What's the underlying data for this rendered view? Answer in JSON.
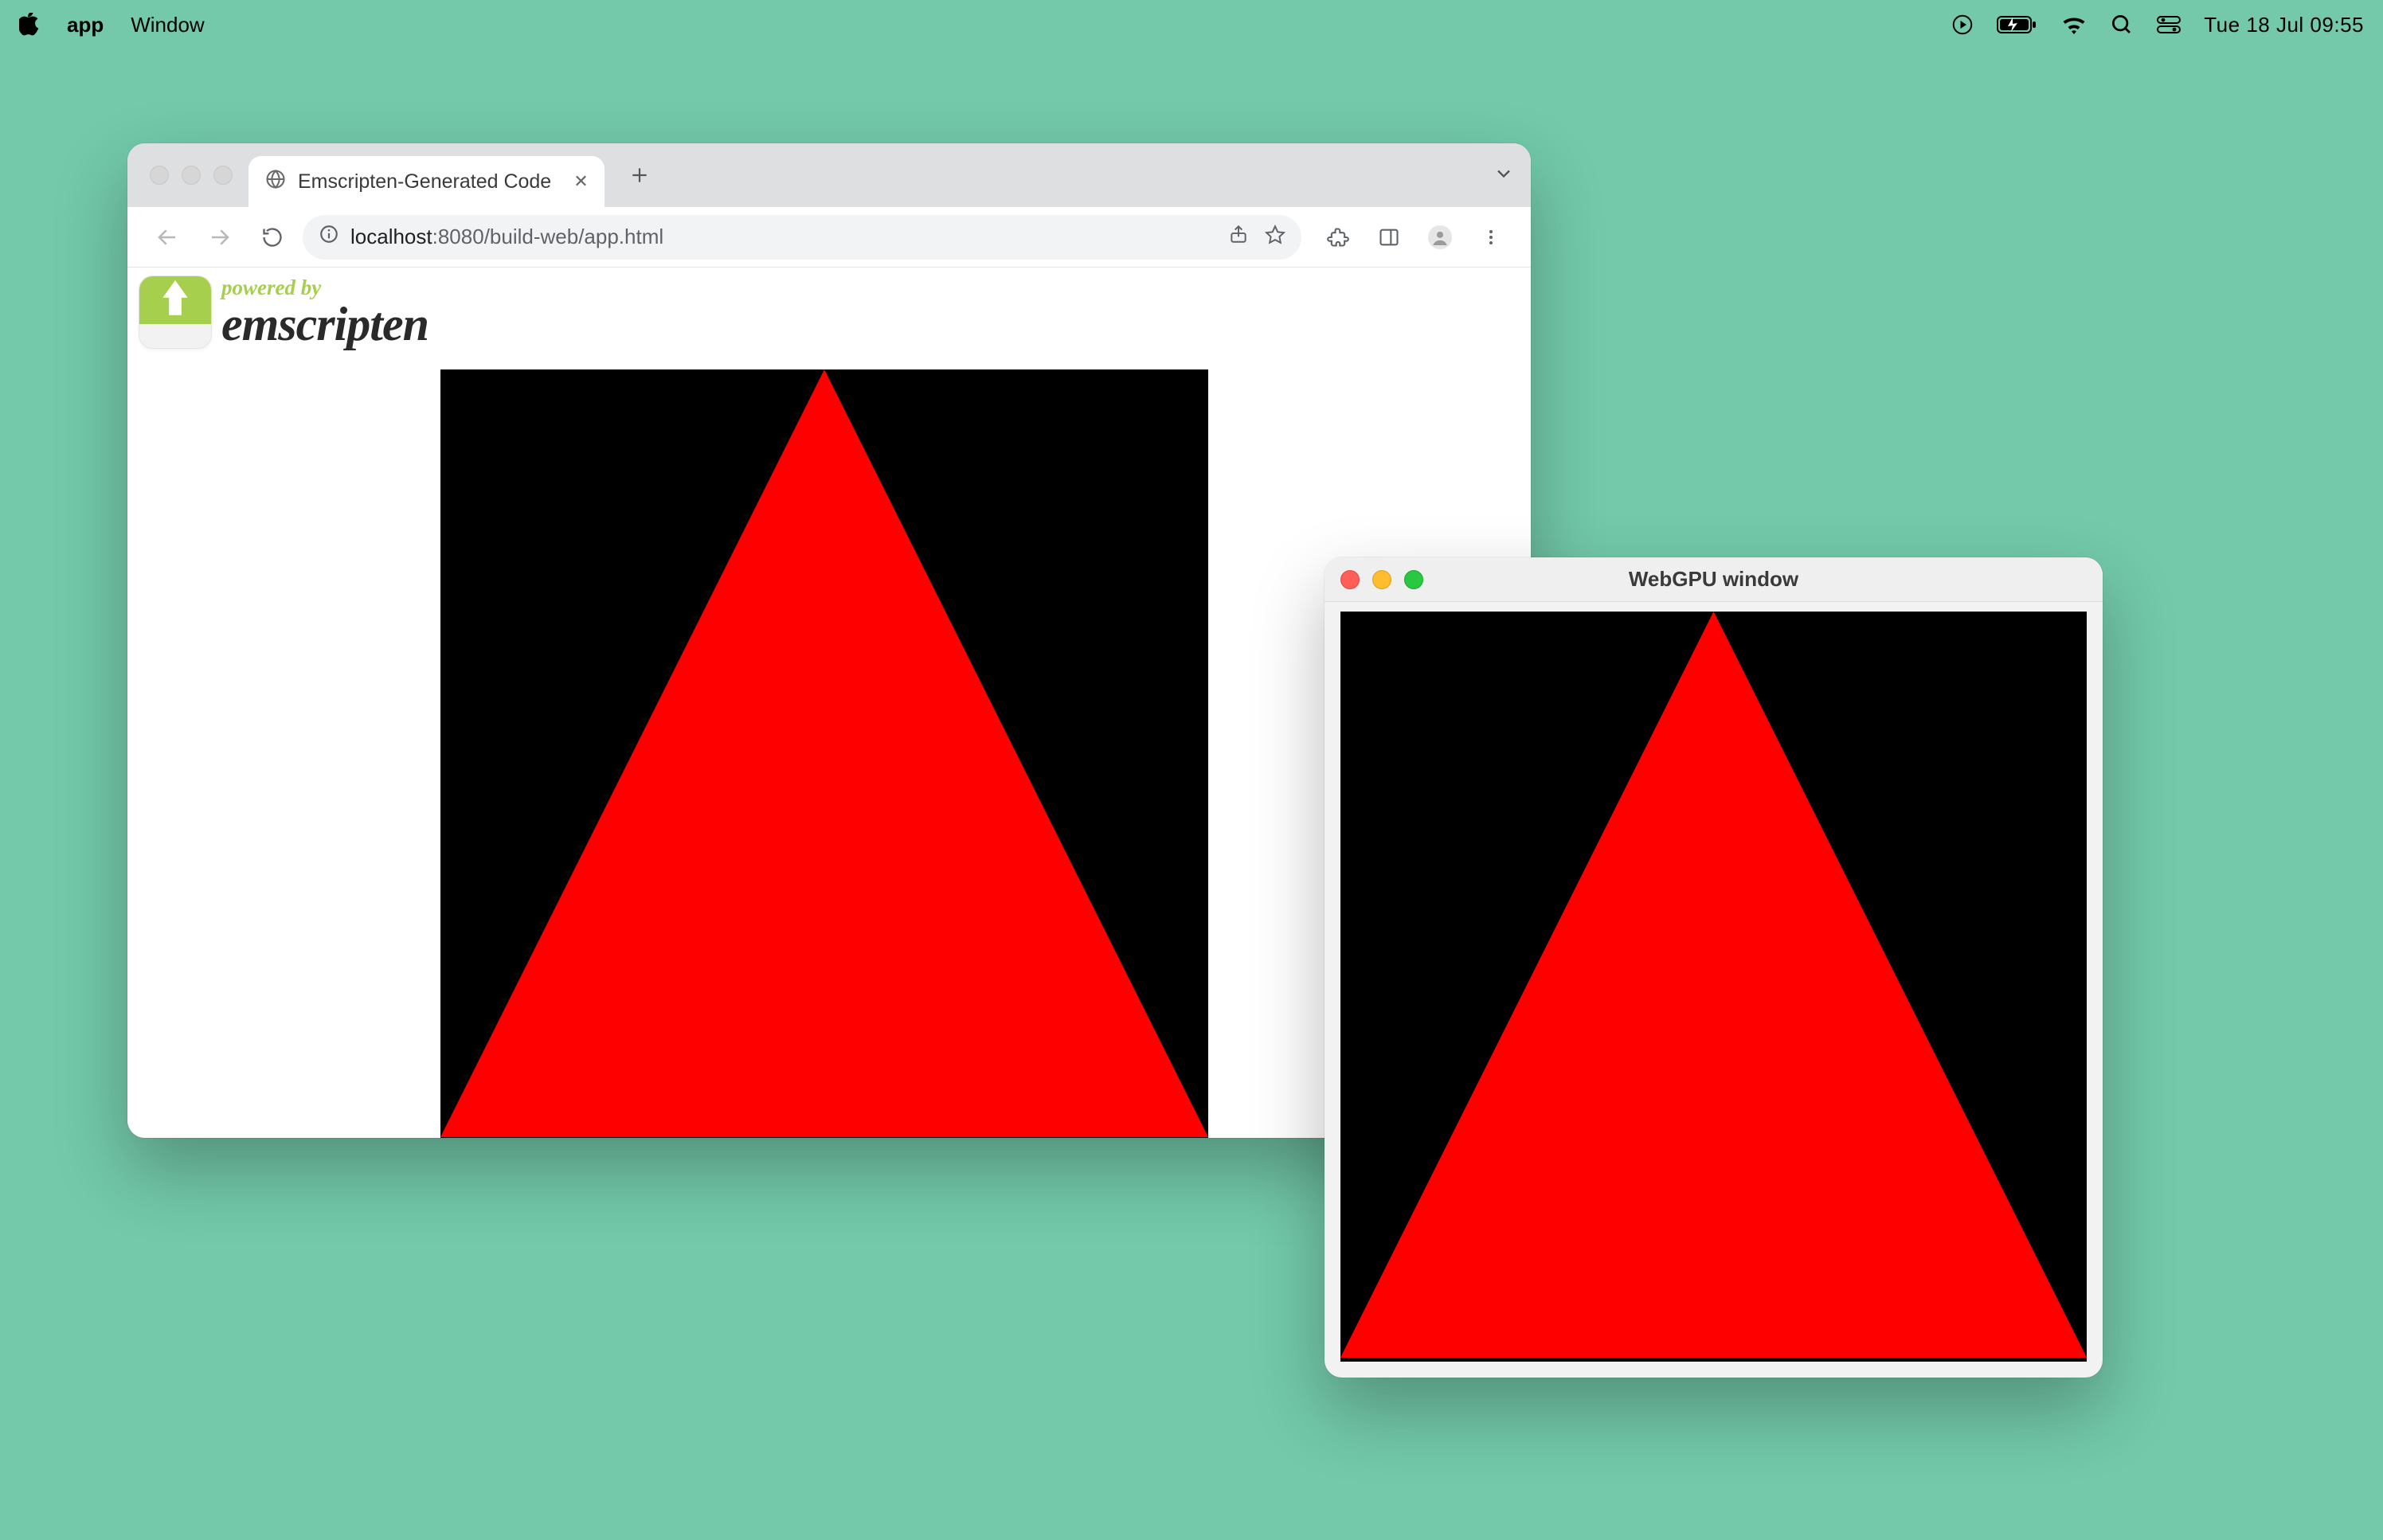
{
  "menubar": {
    "app_name": "app",
    "menus": [
      "Window"
    ],
    "clock": "Tue 18 Jul  09:55"
  },
  "browser": {
    "tab": {
      "title": "Emscripten-Generated Code"
    },
    "url": {
      "host": "localhost",
      "path": ":8080/build-web/app.html"
    },
    "banner": {
      "powered_by": "powered by",
      "name": "emscripten"
    }
  },
  "native_window": {
    "title": "WebGPU window"
  },
  "render": {
    "background": "#000000",
    "triangle_color": "#ff0000"
  }
}
